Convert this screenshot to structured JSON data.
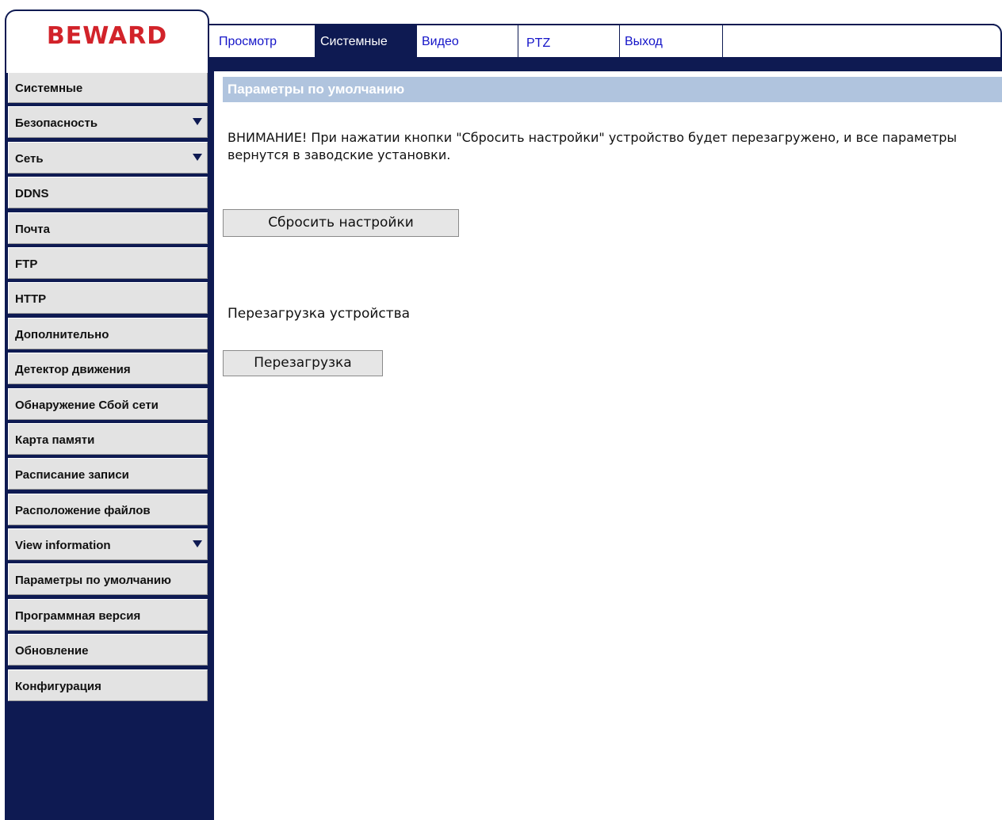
{
  "brand": {
    "logo_text": "BEWARD",
    "logo_color": "#d2232a"
  },
  "colors": {
    "navy": "#0e1a52",
    "section_bar": "#b0c4de",
    "tab_link": "#1515c8"
  },
  "tabs": [
    {
      "label": "Просмотр",
      "active": false
    },
    {
      "label": "Системные",
      "active": true
    },
    {
      "label": "Видео",
      "active": false
    },
    {
      "label": "PTZ",
      "active": false
    },
    {
      "label": "Выход",
      "active": false
    }
  ],
  "sidebar": {
    "items": [
      {
        "label": "Системные",
        "has_submenu": false
      },
      {
        "label": "Безопасность",
        "has_submenu": true
      },
      {
        "label": "Сеть",
        "has_submenu": true
      },
      {
        "label": "DDNS",
        "has_submenu": false
      },
      {
        "label": "Почта",
        "has_submenu": false
      },
      {
        "label": "FTP",
        "has_submenu": false
      },
      {
        "label": "HTTP",
        "has_submenu": false
      },
      {
        "label": "Дополнительно",
        "has_submenu": false
      },
      {
        "label": "Детектор движения",
        "has_submenu": false
      },
      {
        "label": "Обнаружение Сбой сети",
        "has_submenu": false
      },
      {
        "label": "Карта памяти",
        "has_submenu": false
      },
      {
        "label": "Расписание записи",
        "has_submenu": false
      },
      {
        "label": "Расположение файлов",
        "has_submenu": false
      },
      {
        "label": "View information",
        "has_submenu": true
      },
      {
        "label": "Параметры по умолчанию",
        "has_submenu": false
      },
      {
        "label": "Программная версия",
        "has_submenu": false
      },
      {
        "label": "Обновление",
        "has_submenu": false
      },
      {
        "label": "Конфигурация",
        "has_submenu": false
      }
    ]
  },
  "main": {
    "section_title": "Параметры по умолчанию",
    "warning_text": "ВНИМАНИЕ! При нажатии кнопки \"Сбросить настройки\" устройство будет перезагружено, и все параметры вернутся в заводские установки.",
    "reset_button_label": "Сбросить настройки",
    "reboot_label": "Перезагрузка устройства",
    "reboot_button_label": "Перезагрузка"
  }
}
